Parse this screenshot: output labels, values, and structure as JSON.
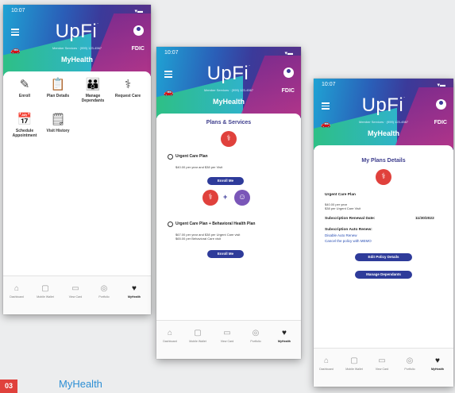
{
  "app": {
    "status_time": "10:07",
    "status_icons": "▾▬",
    "logo": "UpFi",
    "logo_mark": ".",
    "phone_line": "Member Services · (999) 123-4567",
    "fdic": "FDIC",
    "section": "MyHealth"
  },
  "screen1": {
    "tiles": [
      {
        "label": "Enroll",
        "icon": "edit-icon",
        "glyph": "✎"
      },
      {
        "label": "Plan Details",
        "icon": "clipboard-icon",
        "glyph": "📋"
      },
      {
        "label": "Manage Dependants",
        "icon": "family-icon",
        "glyph": "👪"
      },
      {
        "label": "Request Care",
        "icon": "stethoscope-icon",
        "glyph": "⚕"
      },
      {
        "label": "Schedule Appointment",
        "icon": "calendar-icon",
        "glyph": "📅"
      },
      {
        "label": "Visit History",
        "icon": "history-icon",
        "glyph": "🗒"
      }
    ]
  },
  "screen2": {
    "title": "Plans & Services",
    "plan1_name": "Urgent Care Plan",
    "plan1_price": "$40.00 per year and $38 per Visit",
    "enroll_label": "Enroll Me",
    "plus": "+",
    "plan2_name": "Urgent Care Plan + Behavioral Health Plan",
    "plan2_price_1": "$67.00 per year and $38 per Urgent Care visit",
    "plan2_price_2": "$65.00 per Behavioral Care visit"
  },
  "screen3": {
    "title": "My Plans Details",
    "plan_name": "Urgent Care Plan",
    "price_1": "$40.00 per year",
    "price_2": "$38 per Urgent Care Visit",
    "renewal_label": "Subscription Renewal Date:",
    "renewal_date": "11/30/2022",
    "auto_renew_label": "Subscription Auto Renew:",
    "disable_link": "Disable Auto Renew",
    "cancel_link": "Cancel the policy with MEMO",
    "edit_button": "Edit Policy Details",
    "dependants_button": "Manage Dependants"
  },
  "tabbar": [
    {
      "label": "Dashboard",
      "icon": "home-icon",
      "glyph": "⌂"
    },
    {
      "label": "Mobile Wallet",
      "icon": "wallet-icon",
      "glyph": "▢"
    },
    {
      "label": "View Card",
      "icon": "card-icon",
      "glyph": "▭"
    },
    {
      "label": "Portfolio",
      "icon": "portfolio-icon",
      "glyph": "◎"
    },
    {
      "label": "MyHealth",
      "icon": "heart-icon",
      "glyph": "♥"
    }
  ],
  "footer": {
    "number": "03",
    "title": "MyHealth"
  },
  "colors": {
    "accent": "#2e3b9a",
    "red": "#e0413c",
    "purple": "#7a56b8",
    "link": "#2a4fb5"
  }
}
